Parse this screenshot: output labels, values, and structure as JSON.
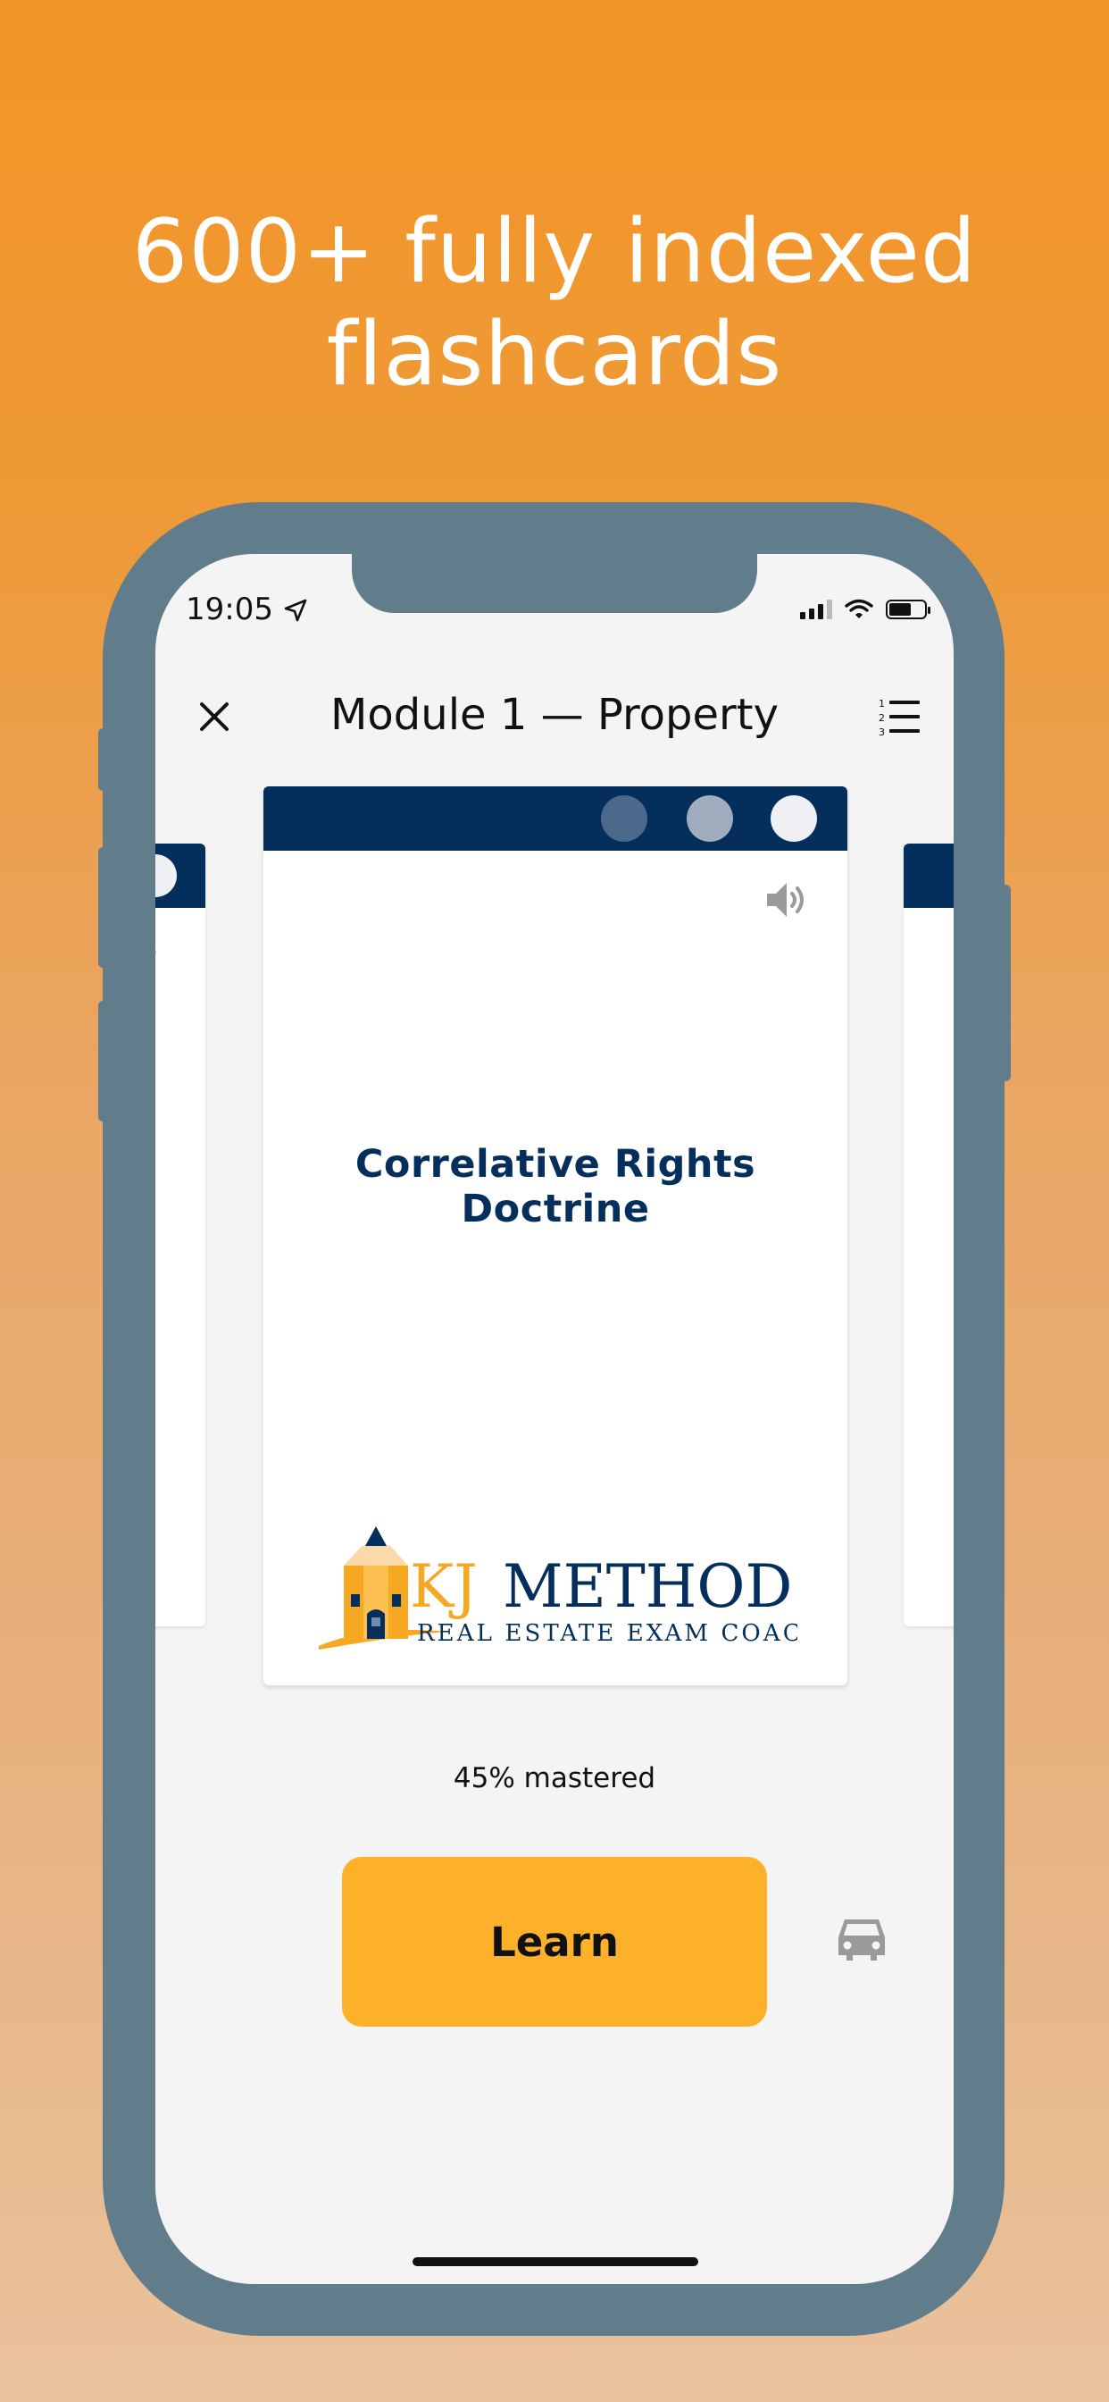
{
  "headline": {
    "line1": "600+ fully indexed",
    "line2": "flashcards"
  },
  "status_bar": {
    "time": "19:05",
    "icons": [
      "location-arrow-icon",
      "cellular-signal-icon",
      "wifi-icon",
      "battery-icon"
    ]
  },
  "nav": {
    "title": "Module 1 — Property",
    "close_icon": "close-icon",
    "list_icon": "numbered-list-icon"
  },
  "card": {
    "term": "Correlative Rights Doctrine",
    "speaker_icon": "speaker-icon",
    "logo": {
      "brand_prefix": "KJ",
      "brand_name": "METHOD",
      "tagline": "REAL ESTATE EXAM COACH"
    }
  },
  "progress": {
    "mastered_text": "45% mastered"
  },
  "actions": {
    "learn_label": "Learn",
    "car_icon": "car-icon"
  },
  "colors": {
    "background_top": "#f39426",
    "phone_frame": "#617d8c",
    "card_bar": "#042e5c",
    "term_text": "#042e5c",
    "learn_button": "#fdb12a",
    "logo_gold": "#f6a823"
  }
}
